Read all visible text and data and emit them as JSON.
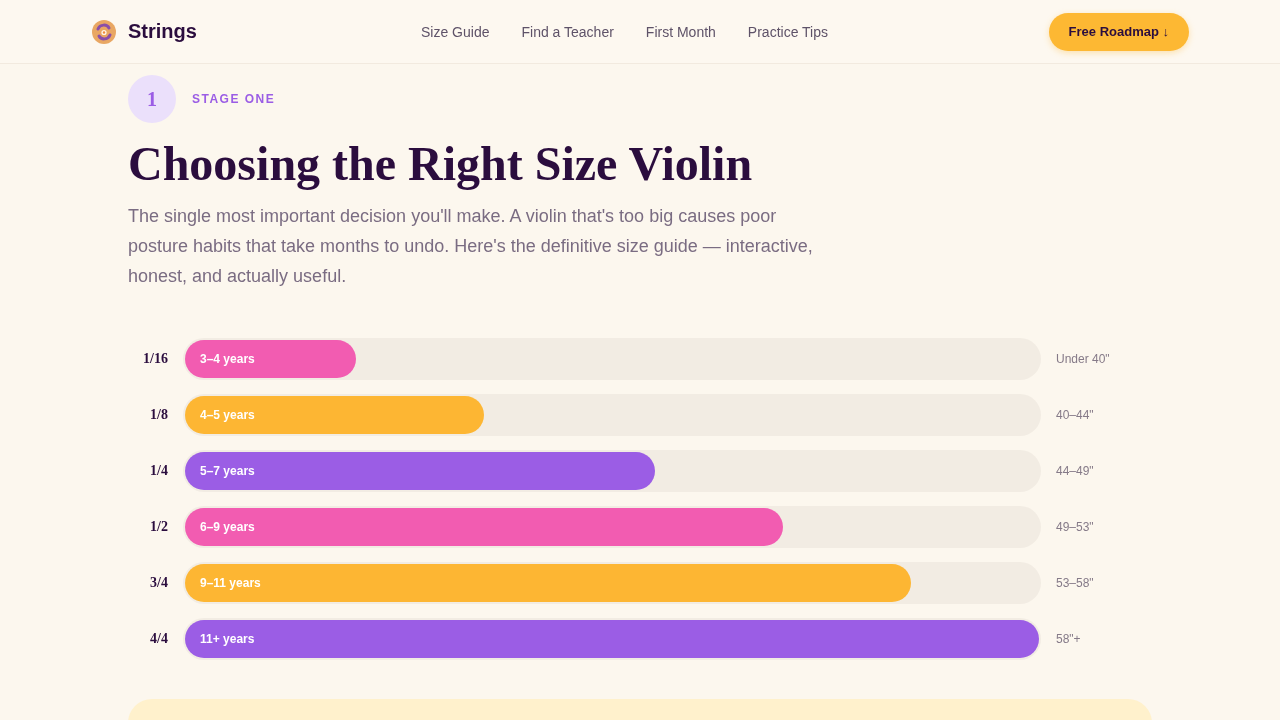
{
  "header": {
    "brand": "Strings",
    "nav": [
      {
        "label": "Size Guide"
      },
      {
        "label": "Find a Teacher"
      },
      {
        "label": "First Month"
      },
      {
        "label": "Practice Tips"
      }
    ],
    "cta": "Free Roadmap ↓"
  },
  "stage": {
    "number": "1",
    "label": "STAGE ONE"
  },
  "title": "Choosing the Right Size Violin",
  "intro": "The single most important decision you'll make. A violin that's too big causes poor posture habits that take months to undo. Here's the definitive size guide — interactive, honest, and actually useful.",
  "sizes": [
    {
      "size": "1/16",
      "ages": "3–4 years",
      "level": 0.2,
      "height": "Under 40\"",
      "color": "#f25cb1"
    },
    {
      "size": "1/8",
      "ages": "4–5 years",
      "level": 0.35,
      "height": "40–44\"",
      "color": "#fdb633"
    },
    {
      "size": "1/4",
      "ages": "5–7 years",
      "level": 0.55,
      "height": "44–49\"",
      "color": "#9b5de5"
    },
    {
      "size": "1/2",
      "ages": "6–9 years",
      "level": 0.7,
      "height": "49–53\"",
      "color": "#f25cb1"
    },
    {
      "size": "3/4",
      "ages": "9–11 years",
      "level": 0.85,
      "height": "53–58\"",
      "color": "#fdb633"
    },
    {
      "size": "4/4",
      "ages": "11+ years",
      "level": 1,
      "height": "58\"+",
      "color": "#9b5de5"
    }
  ]
}
